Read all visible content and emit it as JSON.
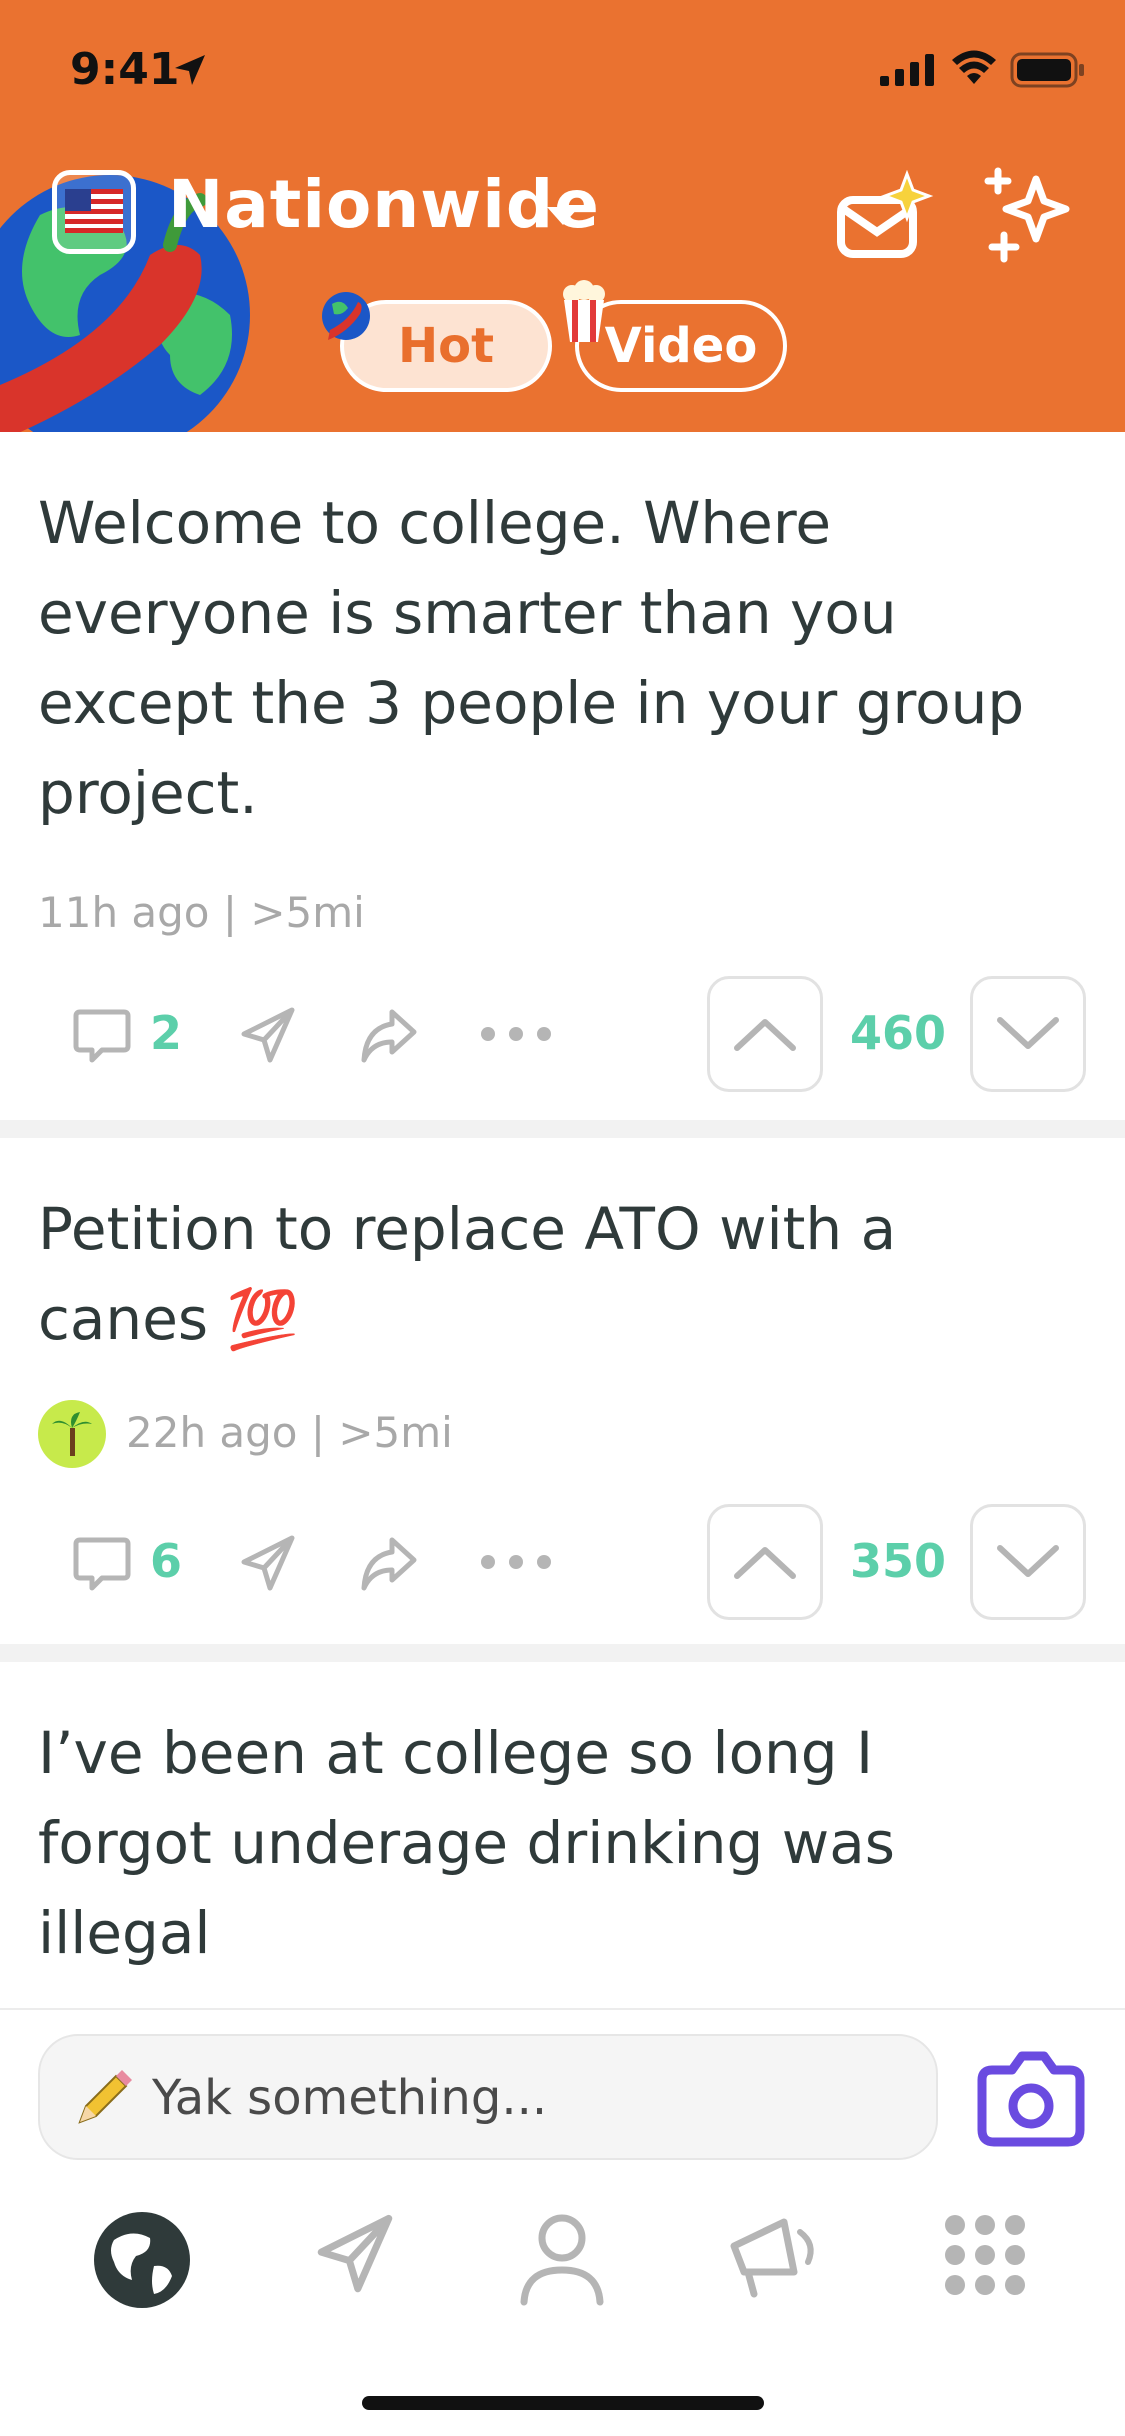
{
  "status_bar": {
    "time": "9:41"
  },
  "header": {
    "location": "Nationwide",
    "flag_emoji": "🇺🇸",
    "tabs": [
      {
        "label": "Hot",
        "emoji": "🌶️",
        "selected": true
      },
      {
        "label": "Video",
        "emoji": "🍿",
        "selected": false
      }
    ],
    "icons": [
      "mail-sparkle-icon",
      "sparkles-icon"
    ]
  },
  "posts": [
    {
      "text": "Welcome to college. Where everyone is smarter than you except the 3 people in your group project.",
      "meta": "11h ago | >5mi",
      "comments": "2",
      "votes": "460"
    },
    {
      "text": "Petition to replace ATO with a canes 💯",
      "meta": "22h ago | >5mi",
      "avatar_emoji": "🌴",
      "comments": "6",
      "votes": "350"
    },
    {
      "text": "I’ve been at college so long I forgot underage drinking was illegal"
    }
  ],
  "compose": {
    "pencil_emoji": "✏️",
    "placeholder": "Yak something..."
  },
  "nav": [
    "globe-icon",
    "send-icon",
    "profile-icon",
    "megaphone-icon",
    "grid-icon"
  ],
  "colors": {
    "brand_orange": "#ea7230",
    "accent_green": "#5ccfaa",
    "camera_purple": "#6a4be0"
  }
}
